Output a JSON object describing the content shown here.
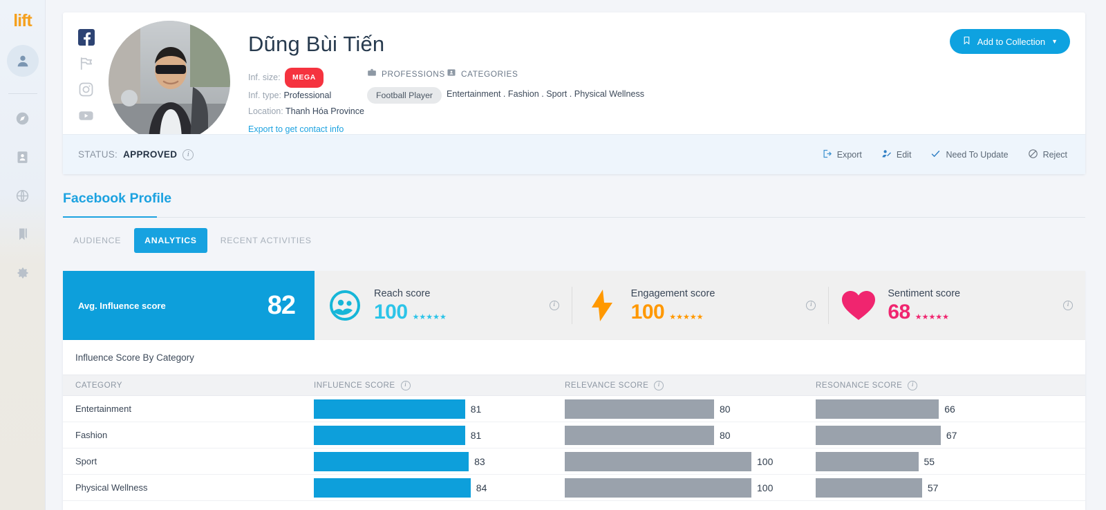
{
  "app": {
    "logo_text": "lift"
  },
  "sidebar": {
    "items": [
      {
        "name": "profile",
        "icon": "person-icon",
        "active": true
      },
      {
        "name": "discover",
        "icon": "compass-icon",
        "active": false
      },
      {
        "name": "contacts",
        "icon": "id-card-icon",
        "active": false
      },
      {
        "name": "global",
        "icon": "globe-icon",
        "active": false
      },
      {
        "name": "collections",
        "icon": "bookmark-icon",
        "active": false
      },
      {
        "name": "settings",
        "icon": "gear-icon",
        "active": false
      }
    ]
  },
  "profile": {
    "name": "Dũng Bùi Tiến",
    "socials": [
      {
        "name": "facebook",
        "icon": "facebook-icon",
        "active": true
      },
      {
        "name": "tiktok",
        "icon": "flag-icon",
        "active": false
      },
      {
        "name": "instagram",
        "icon": "instagram-icon",
        "active": false
      },
      {
        "name": "youtube",
        "icon": "youtube-icon",
        "active": false
      }
    ],
    "inf_size_label": "Inf. size:",
    "inf_size_badge": "MEGA",
    "inf_type_label": "Inf. type:",
    "inf_type_value": "Professional",
    "location_label": "Location:",
    "location_value": "Thanh Hóa Province",
    "contact_link": "Export to get contact info",
    "professions_header": "PROFESSIONS",
    "professions": [
      "Football Player"
    ],
    "categories_header": "CATEGORIES",
    "categories_text": "Entertainment . Fashion . Sport . Physical Wellness",
    "add_to_collection": "Add to Collection"
  },
  "status": {
    "label": "STATUS:",
    "value": "APPROVED",
    "actions": [
      {
        "label": "Export",
        "icon": "export-icon"
      },
      {
        "label": "Edit",
        "icon": "edit-user-icon"
      },
      {
        "label": "Need To Update",
        "icon": "check-icon"
      },
      {
        "label": "Reject",
        "icon": "reject-icon"
      }
    ]
  },
  "section": {
    "title": "Facebook Profile",
    "tabs": [
      {
        "label": "AUDIENCE",
        "active": false
      },
      {
        "label": "ANALYTICS",
        "active": true
      },
      {
        "label": "RECENT ACTIVITIES",
        "active": false
      }
    ]
  },
  "scores": {
    "avg_label": "Avg. Influence score",
    "avg_value": "82",
    "cells": [
      {
        "title": "Reach score",
        "value": "100",
        "stars": "★★★★★",
        "color": "#2cc4e8",
        "icon": "audience-icon"
      },
      {
        "title": "Engagement score",
        "value": "100",
        "stars": "★★★★★",
        "color": "#ff9800",
        "icon": "lightning-icon"
      },
      {
        "title": "Sentiment score",
        "value": "68",
        "stars": "★★★★★",
        "color": "#f0256f",
        "icon": "heart-icon"
      }
    ]
  },
  "table": {
    "caption": "Influence Score By Category",
    "columns": [
      "CATEGORY",
      "INFLUENCE SCORE",
      "RELEVANCE SCORE",
      "RESONANCE SCORE"
    ],
    "rows": [
      {
        "category": "Entertainment",
        "influence": 81,
        "relevance": 80,
        "resonance": 66
      },
      {
        "category": "Fashion",
        "influence": 81,
        "relevance": 80,
        "resonance": 67
      },
      {
        "category": "Sport",
        "influence": 83,
        "relevance": 100,
        "resonance": 55
      },
      {
        "category": "Physical Wellness",
        "influence": 84,
        "relevance": 100,
        "resonance": 57
      }
    ]
  },
  "chart_data": {
    "type": "bar",
    "title": "Influence Score By Category",
    "categories": [
      "Entertainment",
      "Fashion",
      "Sport",
      "Physical Wellness"
    ],
    "series": [
      {
        "name": "INFLUENCE SCORE",
        "values": [
          81,
          81,
          83,
          84
        ],
        "color": "#0d9fdb"
      },
      {
        "name": "RELEVANCE SCORE",
        "values": [
          80,
          80,
          100,
          100
        ],
        "color": "#9aa2ac"
      },
      {
        "name": "RESONANCE SCORE",
        "values": [
          66,
          67,
          55,
          57
        ],
        "color": "#9aa2ac"
      }
    ],
    "xlim": [
      0,
      100
    ],
    "xlabel": "",
    "ylabel": "",
    "grid": false,
    "legend": "none"
  },
  "colors": {
    "accent": "#0d9fdb",
    "brand": "#f5a01e",
    "danger": "#f5333f",
    "bar_gray": "#9aa2ac"
  }
}
